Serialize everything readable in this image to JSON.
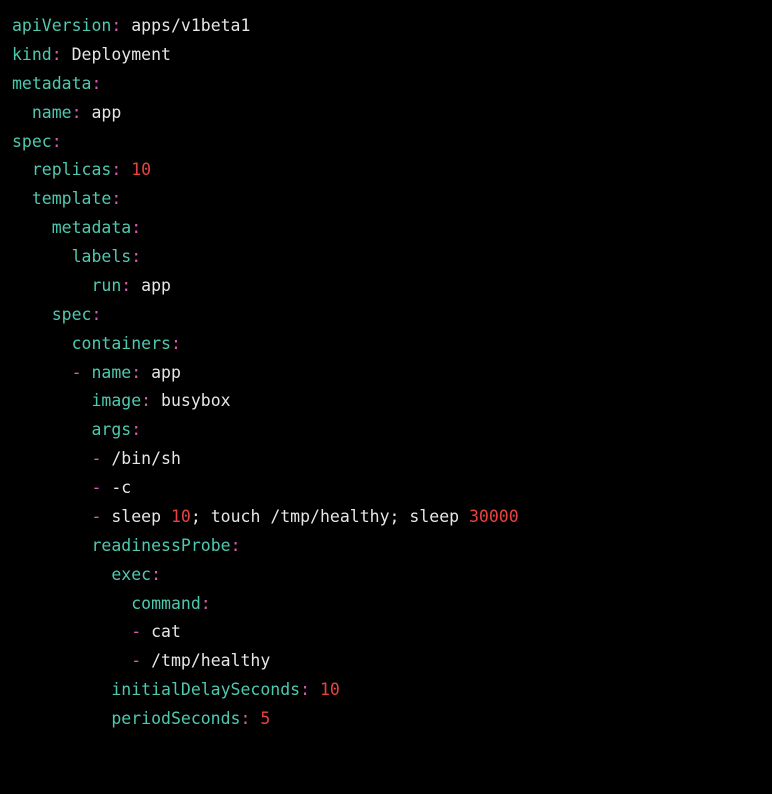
{
  "yaml": {
    "apiVersion_key": "apiVersion",
    "apiVersion_val": "apps/v1beta1",
    "kind_key": "kind",
    "kind_val": "Deployment",
    "metadata_key": "metadata",
    "name_key": "name",
    "name_val": "app",
    "spec_key": "spec",
    "replicas_key": "replicas",
    "replicas_val": "10",
    "template_key": "template",
    "labels_key": "labels",
    "run_key": "run",
    "run_val": "app",
    "containers_key": "containers",
    "image_key": "image",
    "image_val": "busybox",
    "args_key": "args",
    "arg1": "/bin/sh",
    "arg2": "-c",
    "arg3_a": "sleep ",
    "arg3_n1": "10",
    "arg3_b": "; touch /tmp/healthy; sleep ",
    "arg3_n2": "30000",
    "readinessProbe_key": "readinessProbe",
    "exec_key": "exec",
    "command_key": "command",
    "cmd1": "cat",
    "cmd2": "/tmp/healthy",
    "initialDelaySeconds_key": "initialDelaySeconds",
    "initialDelaySeconds_val": "10",
    "periodSeconds_key": "periodSeconds",
    "periodSeconds_val": "5"
  }
}
